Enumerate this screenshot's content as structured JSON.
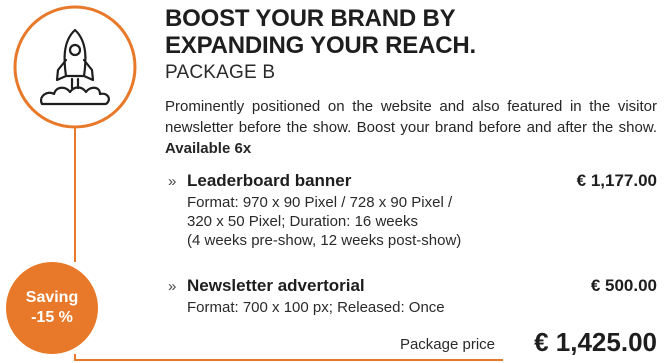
{
  "header": {
    "title_line1": "BOOST YOUR BRAND BY",
    "title_line2": "EXPANDING YOUR REACH.",
    "package_name": "PACKAGE B"
  },
  "description": {
    "text": "Prominently positioned on the website and also featured in the visitor newsletter before the show. Boost your brand before and after the show.",
    "availability": "Available 6x"
  },
  "items": [
    {
      "bullet": "»",
      "name": "Leaderboard banner",
      "price": "€ 1,177.00",
      "details": [
        "Format: 970 x 90 Pixel / 728 x 90 Pixel /",
        "320 x 50 Pixel; Duration: 16 weeks",
        "(4 weeks pre-show, 12 weeks post-show)"
      ]
    },
    {
      "bullet": "»",
      "name": "Newsletter advertorial",
      "price": "€ 500.00",
      "details": [
        "Format: 700 x 100 px; Released: Once"
      ]
    }
  ],
  "badge": {
    "line1": "Saving",
    "line2": "-15 %"
  },
  "package_price": {
    "label": "Package price",
    "value": "€ 1,425.00"
  },
  "icon": "rocket-icon",
  "colors": {
    "accent": "#e8792a",
    "text": "#222222"
  }
}
